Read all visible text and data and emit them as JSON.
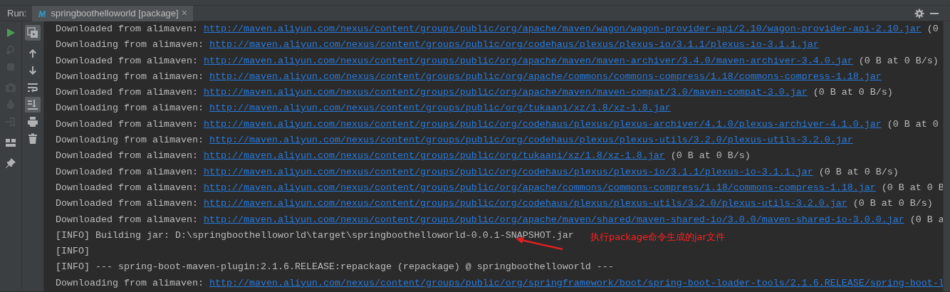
{
  "run_bar": {
    "label": "Run:",
    "tab": {
      "title": "springboothelloworld [package]",
      "close": "×",
      "selected": true
    }
  },
  "left_toolbar": [
    {
      "enabled": true
    },
    {
      "enabled": false
    },
    {
      "enabled": false
    },
    {
      "enabled": false
    },
    {
      "enabled": false
    },
    {
      "enabled": false
    },
    {
      "enabled": true
    },
    {
      "enabled": true
    }
  ],
  "console_toolbar": [
    {
      "selected": true
    },
    {
      "selected": false
    },
    {
      "selected": false
    },
    {
      "selected": false
    },
    {
      "selected": true
    },
    {
      "selected": false
    },
    {
      "selected": false
    }
  ],
  "console_lines": [
    {
      "text": "Downloaded from alimaven: ",
      "url": "http://maven.aliyun.com/nexus/content/groups/public/org/apache/maven/wagon/wagon-provider-api/2.10/wagon-provider-api-2.10.jar",
      "suffix": " (0"
    },
    {
      "text": "Downloading from alimaven: ",
      "url": "http://maven.aliyun.com/nexus/content/groups/public/org/codehaus/plexus/plexus-io/3.1.1/plexus-io-3.1.1.jar"
    },
    {
      "text": "Downloaded from alimaven: ",
      "url": "http://maven.aliyun.com/nexus/content/groups/public/org/apache/maven/maven-archiver/3.4.0/maven-archiver-3.4.0.jar",
      "suffix": " (0 B at 0 B/s)"
    },
    {
      "text": "Downloading from alimaven: ",
      "url": "http://maven.aliyun.com/nexus/content/groups/public/org/apache/commons/commons-compress/1.18/commons-compress-1.18.jar"
    },
    {
      "text": "Downloaded from alimaven: ",
      "url": "http://maven.aliyun.com/nexus/content/groups/public/org/apache/maven/maven-compat/3.0/maven-compat-3.0.jar",
      "suffix": " (0 B at 0 B/s)"
    },
    {
      "text": "Downloading from alimaven: ",
      "url": "http://maven.aliyun.com/nexus/content/groups/public/org/tukaani/xz/1.8/xz-1.8.jar"
    },
    {
      "text": "Downloaded from alimaven: ",
      "url": "http://maven.aliyun.com/nexus/content/groups/public/org/codehaus/plexus/plexus-archiver/4.1.0/plexus-archiver-4.1.0.jar",
      "suffix": " (0 B at 0"
    },
    {
      "text": "Downloading from alimaven: ",
      "url": "http://maven.aliyun.com/nexus/content/groups/public/org/codehaus/plexus/plexus-utils/3.2.0/plexus-utils-3.2.0.jar"
    },
    {
      "text": "Downloaded from alimaven: ",
      "url": "http://maven.aliyun.com/nexus/content/groups/public/org/tukaani/xz/1.8/xz-1.8.jar",
      "suffix": " (0 B at 0 B/s)"
    },
    {
      "text": "Downloaded from alimaven: ",
      "url": "http://maven.aliyun.com/nexus/content/groups/public/org/codehaus/plexus/plexus-io/3.1.1/plexus-io-3.1.1.jar",
      "suffix": " (0 B at 0 B/s)"
    },
    {
      "text": "Downloaded from alimaven: ",
      "url": "http://maven.aliyun.com/nexus/content/groups/public/org/apache/commons/commons-compress/1.18/commons-compress-1.18.jar",
      "suffix": " (0 B at 0 B"
    },
    {
      "text": "Downloaded from alimaven: ",
      "url": "http://maven.aliyun.com/nexus/content/groups/public/org/codehaus/plexus/plexus-utils/3.2.0/plexus-utils-3.2.0.jar",
      "suffix": " (0 B at 0 B/s)"
    },
    {
      "text": "Downloaded from alimaven: ",
      "url": "http://maven.aliyun.com/nexus/content/groups/public/org/apache/maven/shared/maven-shared-io/3.0.0/maven-shared-io-3.0.0.jar",
      "suffix": " (0 B a"
    },
    {
      "text": "[INFO] Building jar: D:\\springboothelloworld\\target\\springboothelloworld-0.0.1-SNAPSHOT.jar",
      "annotation": "执行package命令生成的jar文件"
    },
    {
      "text": "[INFO]"
    },
    {
      "text": "[INFO] --- spring-boot-maven-plugin:2.1.6.RELEASE:repackage (repackage) @ springboothelloworld ---"
    },
    {
      "text": "Downloading from alimaven: ",
      "url": "http://maven.aliyun.com/nexus/content/groups/public/org/springframework/boot/spring-boot-loader-tools/2.1.6.RELEASE/spring-boot-l"
    }
  ]
}
